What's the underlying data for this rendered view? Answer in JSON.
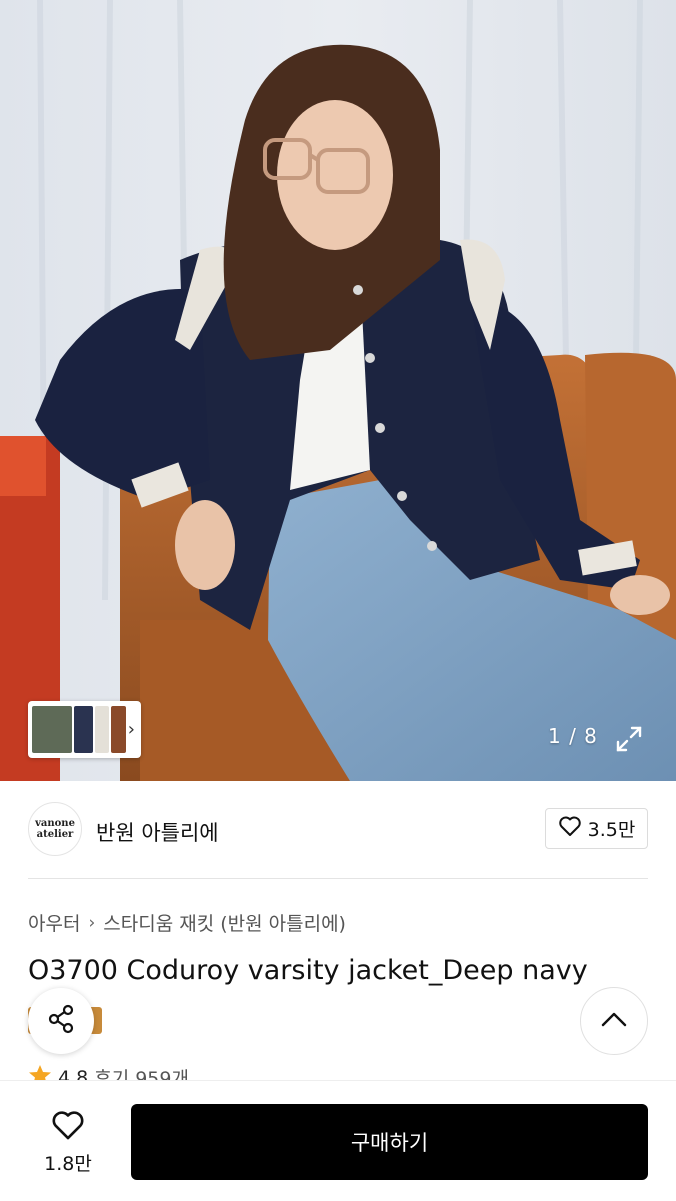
{
  "gallery": {
    "counter": "1 / 8",
    "thumbnail_next_icon": "chevron-right-icon",
    "expand_icon": "expand-icon"
  },
  "brand": {
    "logo_text_line1": "vanone",
    "logo_text_line2": "atelier",
    "name": "반원 아틀리에",
    "like_count": "3.5만"
  },
  "breadcrumb": {
    "category": "아우터",
    "subcategory": "스타디움 재킷 (반원 아틀리에)"
  },
  "product": {
    "title": "O3700 Coduroy varsity jacket_Deep navy",
    "rating": "4.8",
    "reviews": "후기 959개"
  },
  "bottom_bar": {
    "wish_count": "1.8만",
    "buy_label": "구매하기"
  },
  "colors": {
    "accent": "#000000",
    "star": "#f5a623",
    "badge": "#c78a3a"
  }
}
